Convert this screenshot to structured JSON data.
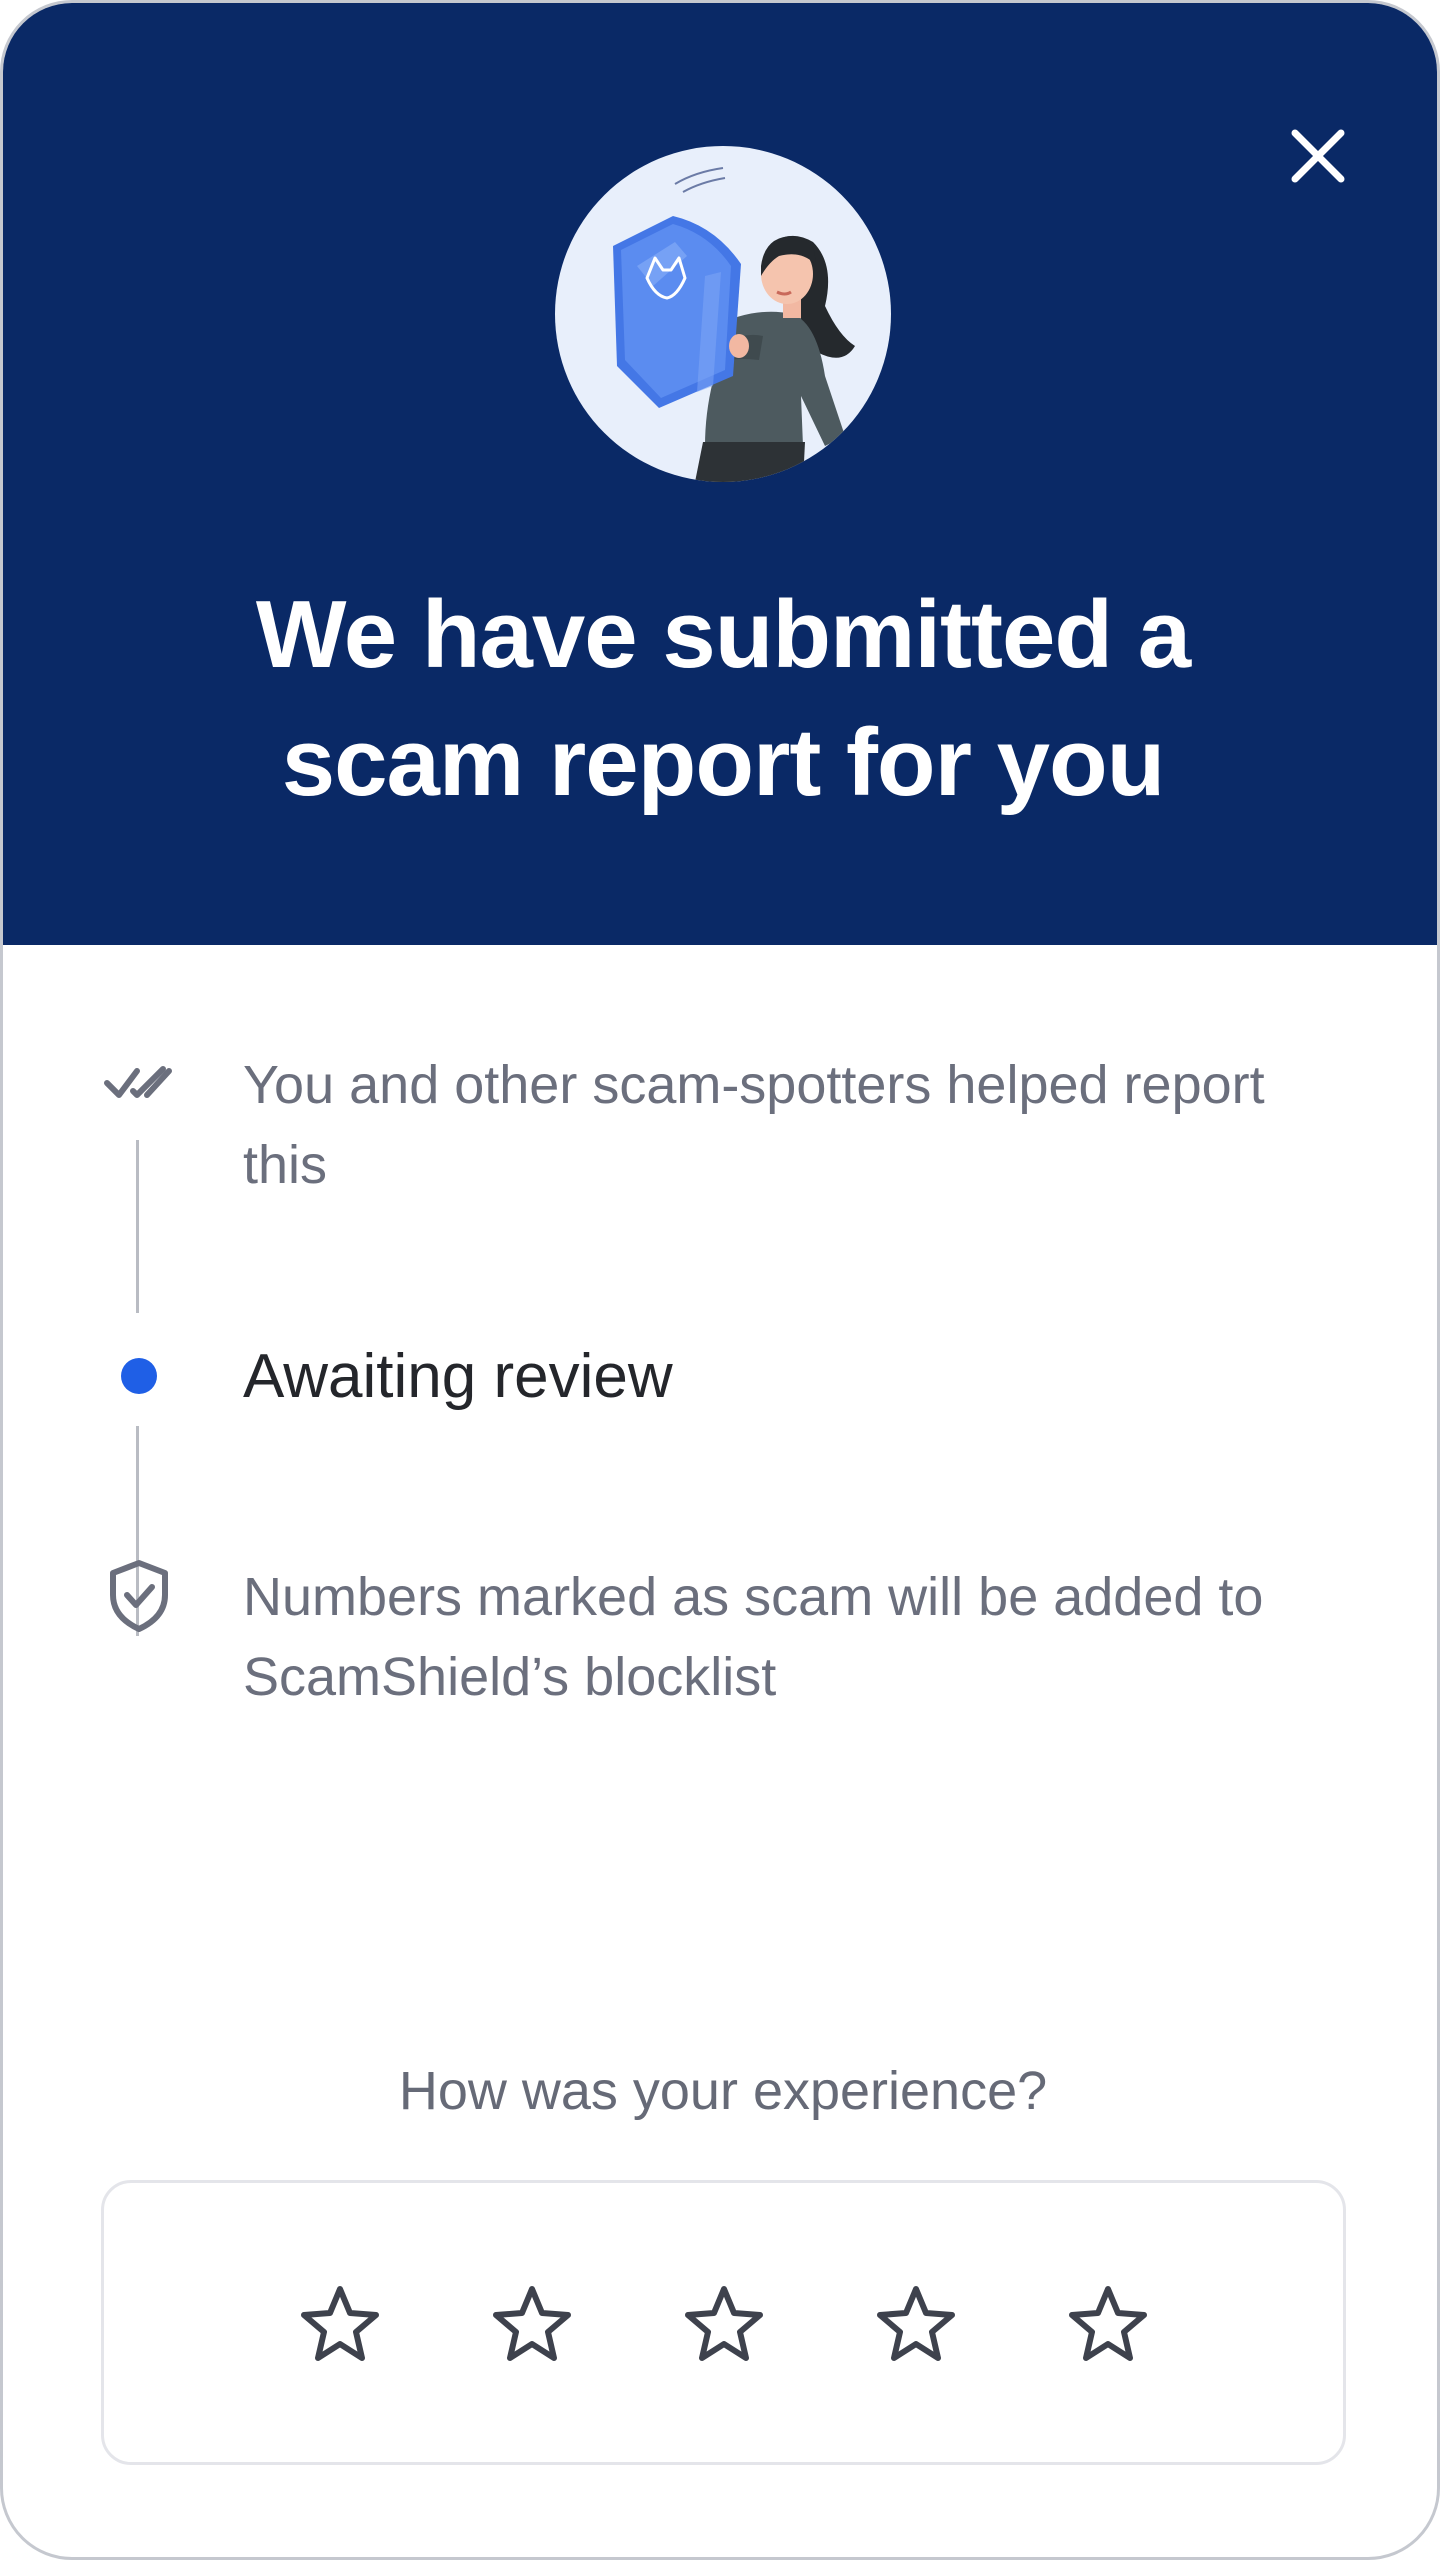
{
  "header": {
    "title": "We have submitted a scam report for you",
    "background_color": "#0a2966",
    "close_icon": "close-icon",
    "illustration": "woman-holding-shield-illustration"
  },
  "timeline": {
    "steps": [
      {
        "icon": "double-check-icon",
        "text": "You and other scam-spotters helped report this",
        "state": "completed"
      },
      {
        "icon": "active-dot-icon",
        "text": "Awaiting review",
        "state": "current",
        "color": "#1f5fe6"
      },
      {
        "icon": "shield-check-icon",
        "text": "Numbers marked as scam will be added to ScamShield’s blocklist",
        "state": "upcoming"
      }
    ]
  },
  "feedback": {
    "question": "How was your experience?",
    "stars_total": 5,
    "star_icon": "star-outline-icon",
    "rating": 0
  }
}
